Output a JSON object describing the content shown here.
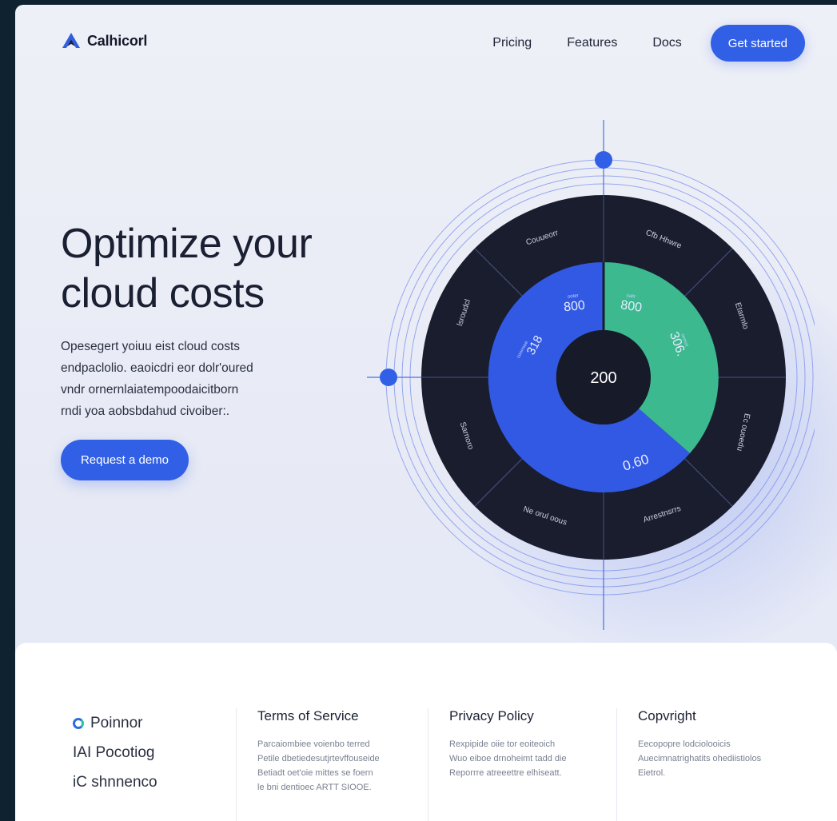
{
  "header": {
    "brand": "Calhicorl",
    "nav": [
      "Pricing",
      "Features",
      "Docs"
    ],
    "cta": "Get started"
  },
  "hero": {
    "title_lines": [
      "Optimize your",
      "cloud costs"
    ],
    "subtitle_lines": [
      "Opesegert yoiuu eist cloud costs",
      "endpaclolio. eaoicdri eor dolr'oured",
      "vndr ornernlaiatempoodaicitborn",
      "rndi yoa aobsbdahud civoiber:."
    ],
    "demo_button": "Request a demo"
  },
  "chart": {
    "center_value": "200",
    "sector_labels": [
      "Couueorr",
      "Cfb Hhwre",
      "Etarmlo",
      "Ec ouoedu",
      "Arrestnsrrs",
      "Ne orul oous",
      "Sarnoro",
      "lsroudcl"
    ],
    "segment_labels": [
      "800",
      "800",
      "306.",
      "0.60",
      "318"
    ],
    "segment_small_labels": [
      "ooter",
      "oaltr",
      "oemot",
      "conrrsoe"
    ],
    "colors": {
      "blue": "#3259e3",
      "green": "#3cb98f",
      "dark": "#1a1d2e",
      "line": "#4a6fe6"
    }
  },
  "footer": {
    "brand_list": [
      "Poinnor",
      "IAI Pocotiog",
      "iC shnnenco"
    ],
    "columns": [
      {
        "title": "Terms of Service",
        "lines": [
          "Parcaiombiee voienbo terred",
          "Petile dbetiedesutjrtevffouseide",
          "Betiadt oet'oie mittes se foern",
          "le bni dentioec ARTT SIOOE."
        ]
      },
      {
        "title": "Privacy Policy",
        "lines": [
          "Rexpipide oiie tor eoiteoich",
          "Wuo eiboe drnoheimt tadd die",
          "Reporrre atreeettre elhiseatt."
        ]
      },
      {
        "title": "Copvright",
        "lines": [
          "Eecopopre lodciolooicis",
          "Auecimnatrighatits ohediistiolos",
          "Eietrol."
        ]
      }
    ]
  }
}
